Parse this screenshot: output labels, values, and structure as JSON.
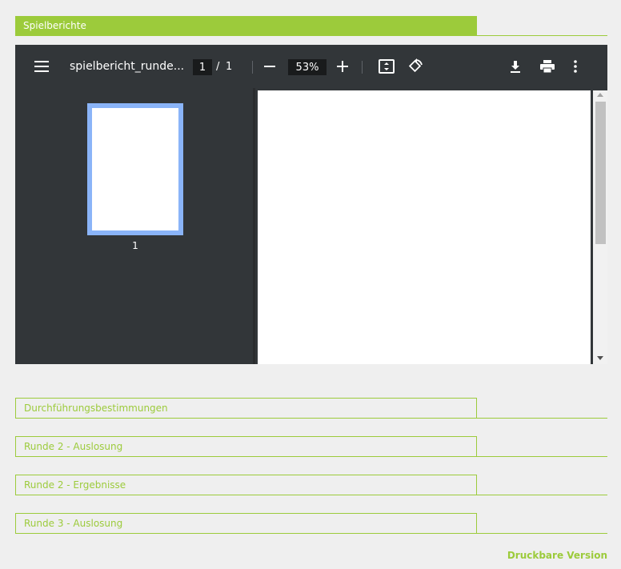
{
  "sections": {
    "active": "Spielberichte",
    "collapsed": [
      "Durchführungsbestimmungen",
      "Runde 2 - Auslosung",
      "Runde 2 - Ergebnisse",
      "Runde 3 - Auslosung"
    ]
  },
  "viewer": {
    "title": "spielbericht_runde...",
    "page_current": "1",
    "page_separator": "/",
    "page_total": "1",
    "zoom": "53%",
    "thumbnail_number": "1",
    "icons": [
      "menu-icon",
      "minus-icon",
      "plus-icon",
      "fit-page-icon",
      "rotate-icon",
      "download-icon",
      "print-icon",
      "more-vert-icon"
    ]
  },
  "footer": {
    "print_version": "Druckbare Version"
  },
  "colors": {
    "accent": "#9ccb3b",
    "viewer_bg": "#323639",
    "thumb_border": "#8ab4f8"
  }
}
